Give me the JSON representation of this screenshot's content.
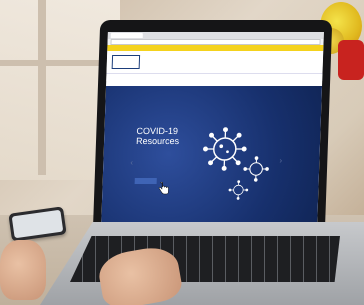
{
  "browser": {
    "tab_title": "",
    "address": "",
    "banner": ""
  },
  "site": {
    "logo_text": "",
    "contacts": [
      "",
      "",
      ""
    ],
    "nav": [
      "",
      "",
      "",
      "",
      "",
      "",
      ""
    ]
  },
  "hero": {
    "title_line1": "COVID-19",
    "title_line2": "Resources",
    "body": "",
    "button": ""
  },
  "icons": [
    "virus-icon",
    "pointer-cursor-icon",
    "chevron-left-icon",
    "chevron-right-icon"
  ],
  "colors": {
    "hero_bg": "#17306d",
    "banner": "#f4d21d",
    "brand_blue": "#1b3d7a",
    "accent_red": "#c8232c"
  }
}
